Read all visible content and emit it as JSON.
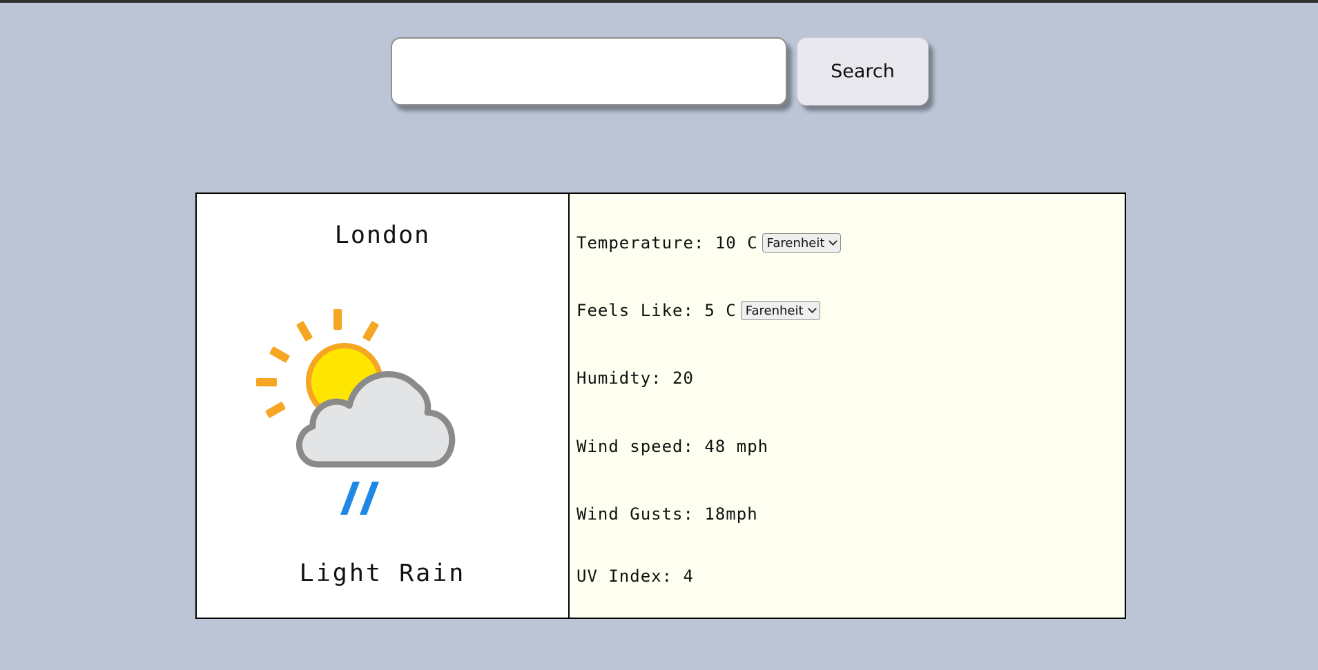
{
  "search": {
    "value": "",
    "placeholder": "",
    "button_label": "Search"
  },
  "weather": {
    "city": "London",
    "condition": "Light Rain",
    "icon": "sun-cloud-rain-icon",
    "temperature": {
      "label": "Temperature:",
      "value": "10 C",
      "unit_option": "Farenheit"
    },
    "feels_like": {
      "label": "Feels Like:",
      "value": "5 C",
      "unit_option": "Farenheit"
    },
    "humidity": {
      "label": "Humidty:",
      "value": "20"
    },
    "wind_speed": {
      "label": "Wind speed:",
      "value": "48 mph"
    },
    "wind_gusts": {
      "label": "Wind Gusts:",
      "value": "18mph"
    },
    "uv_index": {
      "label": "UV Index:",
      "value": "4"
    }
  },
  "colors": {
    "page_background": "#bbc5d6",
    "details_background": "#fefff0",
    "sun": "#ffe600",
    "sun_rays": "#f5a623",
    "cloud": "#e3e4e6",
    "cloud_outline": "#8a8a8a",
    "rain": "#1e88e5"
  }
}
